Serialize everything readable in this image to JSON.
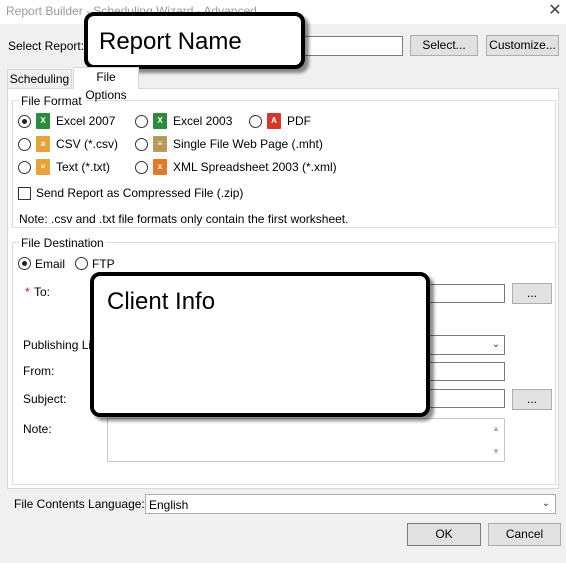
{
  "window": {
    "title": "Report Builder - Scheduling Wizard - Advanced",
    "close_glyph": "✕"
  },
  "header": {
    "select_report_label": "Select Report:",
    "select_button": "Select...",
    "customize_button": "Customize..."
  },
  "tabs": [
    {
      "label": "Scheduling",
      "active": false
    },
    {
      "label": "File Options",
      "active": true
    }
  ],
  "file_format": {
    "legend": "File Format",
    "options": [
      {
        "label": "Excel 2007",
        "selected": true,
        "icon": "excel-icon"
      },
      {
        "label": "Excel 2003",
        "selected": false,
        "icon": "excel-icon"
      },
      {
        "label": "PDF",
        "selected": false,
        "icon": "pdf-icon"
      },
      {
        "label": "CSV (*.csv)",
        "selected": false,
        "icon": "csv-icon"
      },
      {
        "label": "Single File Web Page (.mht)",
        "selected": false,
        "icon": "web-page-icon"
      },
      {
        "label": "Text (*.txt)",
        "selected": false,
        "icon": "text-file-icon"
      },
      {
        "label": "XML Spreadsheet 2003 (*.xml)",
        "selected": false,
        "icon": "xml-icon"
      }
    ],
    "compress_label": "Send Report as Compressed File (.zip)",
    "compress_checked": false,
    "note": "Note: .csv and .txt file formats only contain the first worksheet."
  },
  "file_destination": {
    "legend": "File Destination",
    "email_label": "Email",
    "ftp_label": "FTP",
    "email_selected": true,
    "required_marker": "*",
    "to_label": "To:",
    "publishing_label": "Publishing Lis",
    "from_label": "From:",
    "subject_label": "Subject:",
    "note_label": "Note:",
    "browse_glyph": "..."
  },
  "language": {
    "label": "File Contents Language:",
    "value": "English"
  },
  "footer": {
    "ok_button": "OK",
    "cancel_button": "Cancel"
  },
  "callouts": {
    "report_name": "Report Name",
    "client_info": "Client Info"
  },
  "colors": {
    "excel_green": "#2e8b3e",
    "pdf_red": "#d9362b",
    "csv_orange": "#e8a23a",
    "required_red": "#e81123"
  }
}
